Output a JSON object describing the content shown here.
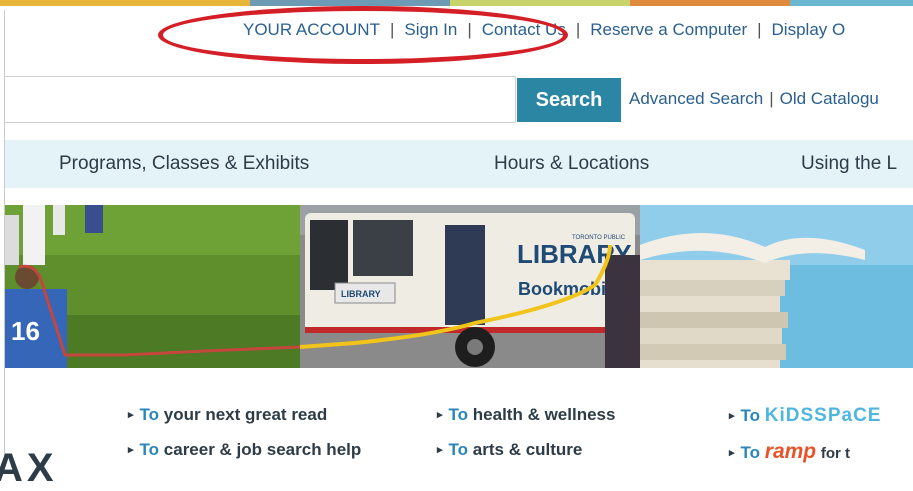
{
  "colors": {
    "link": "#2a5f8f",
    "search_button": "#2a86a3",
    "nav_background": "#e3f3f7",
    "highlight_ellipse": "#d41f26",
    "top_strip": [
      "#e6b53a",
      "#6d9bb5",
      "#c9d36b",
      "#e08a3d",
      "#6ab8d0"
    ]
  },
  "account_nav": {
    "items": [
      "YOUR ACCOUNT",
      "Sign In",
      "Contact Us",
      "Reserve a Computer",
      "Display O"
    ],
    "separator": "|"
  },
  "search": {
    "value": "",
    "button_label": "Search",
    "links": [
      "Advanced Search",
      "Old Catalogu"
    ],
    "separator": "|"
  },
  "main_nav": {
    "items": [
      "Programs, Classes & Exhibits",
      "Hours & Locations",
      "Using the L"
    ]
  },
  "banner": {
    "bus_sign": "LIBRARY",
    "bus_sign_small": "TORONTO PUBLIC",
    "bus_label": "Bookmobile",
    "bus_door_sign": "LIBRARY",
    "player_number": "16"
  },
  "quick_links": {
    "arrow": "▸",
    "to": "To",
    "col1": [
      "your next great read",
      "career & job search help"
    ],
    "col2": [
      "health & wellness",
      "arts & culture"
    ],
    "col3_kidsspace": "KiDSSPaCE",
    "col3_ramp": "ramp",
    "col3_ramp_suffix": "for t"
  },
  "bottom_fragment": "AX"
}
